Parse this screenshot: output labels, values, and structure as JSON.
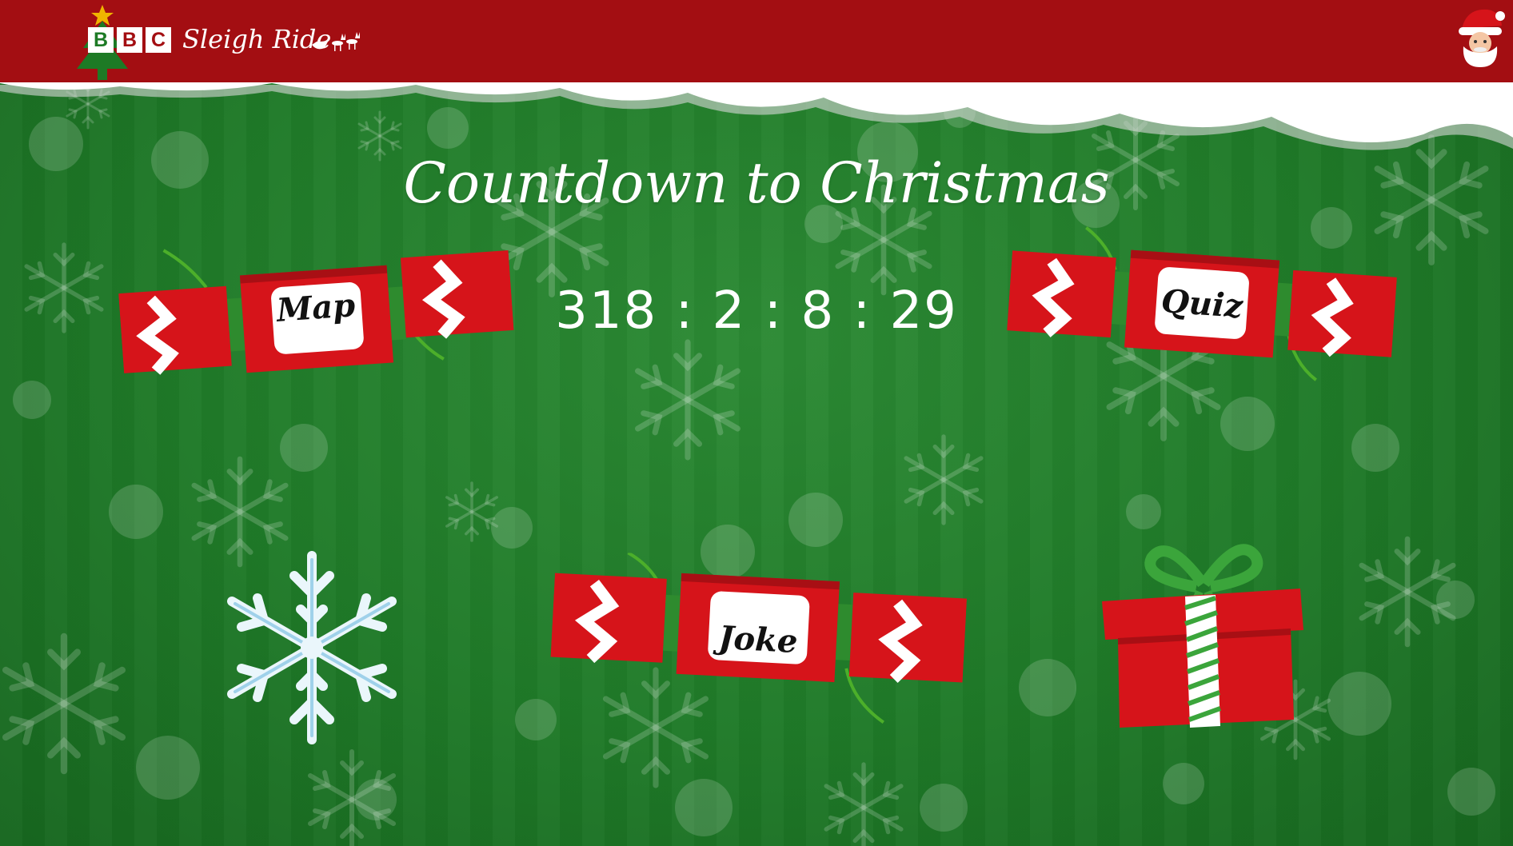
{
  "header": {
    "brand_letters": [
      "B",
      "B",
      "C"
    ],
    "brand_name": "Sleigh Ride",
    "colors": {
      "bar": "#a30e12",
      "background": "#1f7a28"
    },
    "icons": {
      "tree": "christmas-tree-icon",
      "sleigh": "reindeer-sleigh-icon",
      "santa": "santa-icon"
    }
  },
  "main": {
    "title": "Countdown to Christmas",
    "countdown": "318 : 2 : 8 : 29"
  },
  "crackers": {
    "map_label": "Map",
    "quiz_label": "Quiz",
    "joke_label": "Joke"
  },
  "decorations": {
    "snowflake": "snowflake-icon",
    "gift": "gift-box-icon"
  }
}
